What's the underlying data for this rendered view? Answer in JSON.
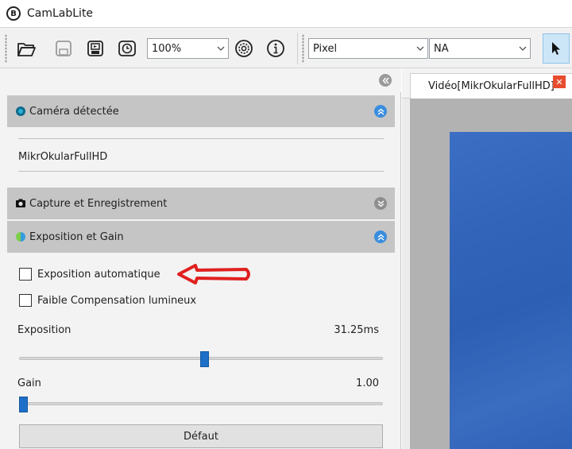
{
  "app": {
    "title": "CamLabLite",
    "logo_letter": "B"
  },
  "toolbar": {
    "zoom_value": "100%",
    "unit_value": "Pixel",
    "measure_value": "NA"
  },
  "sections": {
    "camera": {
      "title": "Caméra détectée",
      "device_name": "MikrOkularFullHD"
    },
    "capture": {
      "title": "Capture et Enregistrement"
    },
    "exposure": {
      "title": "Exposition et Gain",
      "auto_exposure_label": "Exposition automatique",
      "auto_exposure_checked": false,
      "low_light_label": "Faible Compensation lumineux",
      "low_light_checked": false,
      "exposure_label": "Exposition",
      "exposure_value": "31.25ms",
      "exposure_slider_fraction": 0.51,
      "gain_label": "Gain",
      "gain_value": "1.00",
      "gain_slider_fraction": 0.0,
      "default_button_label": "Défaut"
    }
  },
  "video_tab": {
    "title": "Vidéo[MikrOkularFullHD]",
    "close_symbol": "✕"
  },
  "colors": {
    "accent": "#3a8dde",
    "slider_thumb": "#1e6fc7",
    "close_button": "#e74c2e",
    "annotation_arrow": "#e02020"
  }
}
